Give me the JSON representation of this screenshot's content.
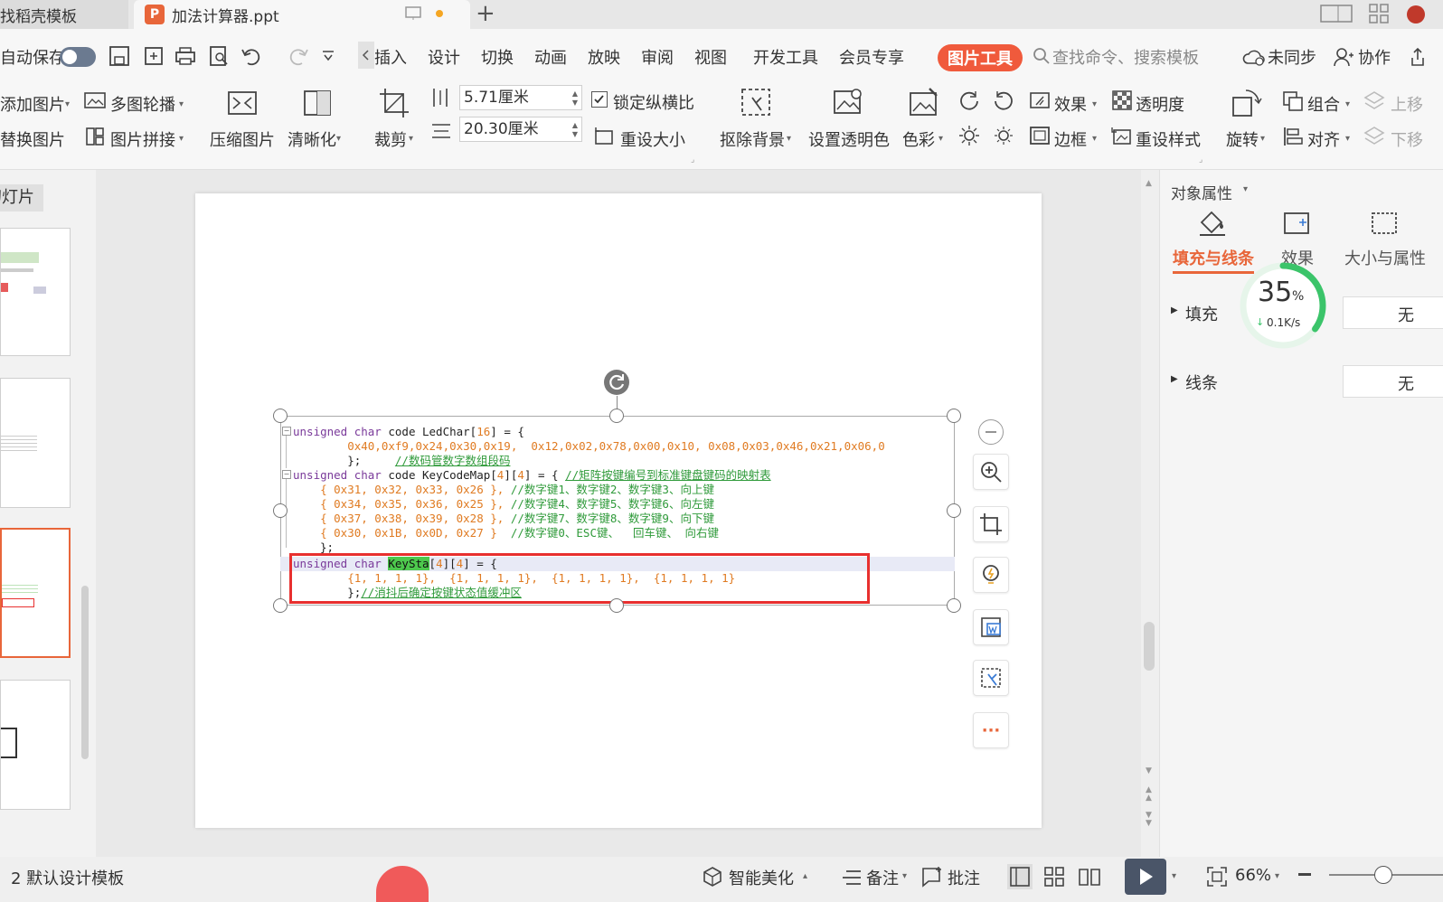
{
  "tabs": {
    "tab1_label": "找稻壳模板",
    "tab2_icon": "P",
    "tab2_label": "加法计算器.ppt",
    "new_tab": "+"
  },
  "menu": {
    "autosave": "自动保存",
    "items": [
      "插入",
      "设计",
      "切换",
      "动画",
      "放映",
      "审阅",
      "视图",
      "开发工具",
      "会员专享"
    ],
    "picture_tools": "图片工具",
    "search_placeholder": "查找命令、搜索模板",
    "sync": "未同步",
    "collab": "协作"
  },
  "ribbon": {
    "add_picture": "添加图片",
    "multi_carousel": "多图轮播",
    "replace_picture": "替换图片",
    "picture_collage": "图片拼接",
    "compress": "压缩图片",
    "sharpen": "清晰化",
    "crop": "裁剪",
    "width_value": "5.71厘米",
    "height_value": "20.30厘米",
    "lock_ratio": "锁定纵横比",
    "reset_size": "重设大小",
    "remove_bg": "抠除背景",
    "set_transparent": "设置透明色",
    "color": "色彩",
    "effect": "效果",
    "transparency": "透明度",
    "border": "边框",
    "reset_style": "重设样式",
    "rotate": "旋转",
    "group": "组合",
    "align": "对齐",
    "move_up": "上移",
    "move_down": "下移"
  },
  "left_panel": {
    "header": "幻灯片"
  },
  "code": {
    "line1_kw": "unsigned char",
    "line1_tx": " code LedChar[",
    "line1_num": "16",
    "line1_end": "] = {",
    "line2": "        0x40,0xf9,0x24,0x30,0x19,  0x12,0x02,0x78,0x00,0x10, 0x08,0x03,0x46,0x21,0x06,0",
    "line3_tx": "        };     ",
    "line3_cm": "//数码管数字数组段码",
    "line4_kw": "unsigned char",
    "line4_tx": " code KeyCodeMap[",
    "line4_n1": "4",
    "line4_mid": "][",
    "line4_n2": "4",
    "line4_end": "] = { ",
    "line4_cm": "//矩阵按键编号到标准键盘键码的映射表",
    "line5_tx": "    { 0x31, 0x32, 0x33, 0x26 }, ",
    "line5_cm": "//数字键1、数字键2、数字键3、向上键",
    "line6_tx": "    { 0x34, 0x35, 0x36, 0x25 }, ",
    "line6_cm": "//数字键4、数字键5、数字键6、向左键",
    "line7_tx": "    { 0x37, 0x38, 0x39, 0x28 }, ",
    "line7_cm": "//数字键7、数字键8、数字键9、向下键",
    "line8_tx": "    { 0x30, 0x1B, 0x0D, 0x27 }  ",
    "line8_cm": "//数字键0、ESC键、  回车键、 向右键",
    "line9_tx": "};",
    "line10_kw": "unsigned char",
    "line10_tx": " ",
    "line10_hl": "KeySta",
    "line10_b1": "[",
    "line10_n1": "4",
    "line10_b2": "][",
    "line10_n2": "4",
    "line10_end": "] = {",
    "line11": "        {1, 1, 1, 1},  {1, 1, 1, 1},  {1, 1, 1, 1},  {1, 1, 1, 1}",
    "line12_tx": "        };",
    "line12_cm": "//消抖后确定按键状态值缓冲区"
  },
  "right_panel": {
    "title": "对象属性",
    "tab_fill": "填充与线条",
    "tab_effect": "效果",
    "tab_size": "大小与属性",
    "fill_label": "填充",
    "fill_value": "无",
    "line_label": "线条",
    "line_value": "无",
    "net_percent": "35",
    "net_percent_unit": "%",
    "net_speed": "0.1K/s"
  },
  "status": {
    "slide_info": "2 默认设计模板",
    "smart_beautify": "智能美化",
    "notes": "备注",
    "comments": "批注",
    "zoom": "66%"
  },
  "colors": {
    "accent": "#f05a3c",
    "selection_red": "#e8302f",
    "progress_green": "#3bc46a"
  }
}
